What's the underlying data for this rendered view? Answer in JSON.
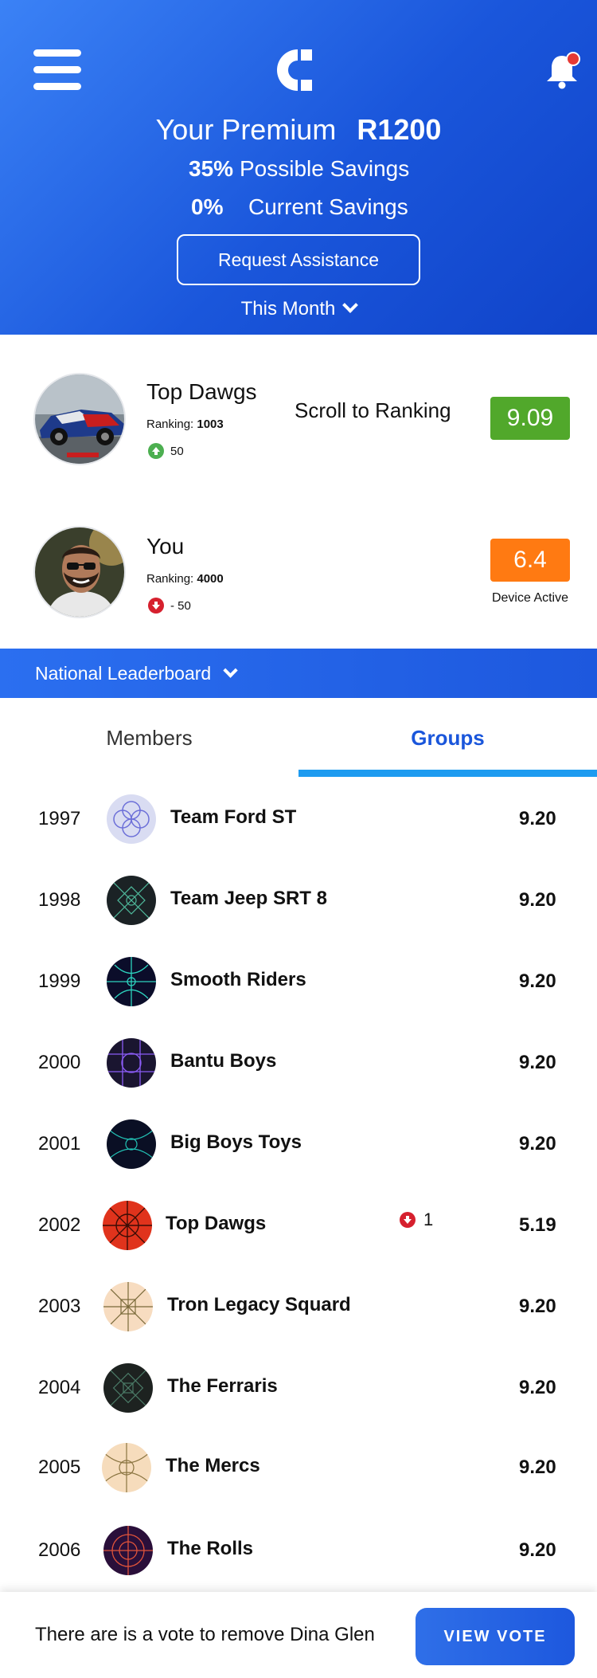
{
  "header": {
    "premium_label": "Your Premium",
    "premium_value": "R1200",
    "possible_pct": "35%",
    "possible_label": "Possible Savings",
    "current_pct": "0%",
    "current_label": "Current Savings",
    "assist_label": "Request Assistance",
    "period_label": "This Month"
  },
  "top_card": {
    "name": "Top Dawgs",
    "ranking_label": "Ranking:",
    "ranking_value": "1003",
    "change": "50",
    "scroll_label": "Scroll to Ranking",
    "score": "9.09"
  },
  "you_card": {
    "name": "You",
    "ranking_label": "Ranking:",
    "ranking_value": "4000",
    "change": "- 50",
    "score": "6.4",
    "status": "Device Active"
  },
  "leaderboard": {
    "label": "National Leaderboard"
  },
  "tabs": {
    "members": "Members",
    "groups": "Groups"
  },
  "rows": [
    {
      "rank": "1997",
      "name": "Team Ford ST",
      "score": "9.20"
    },
    {
      "rank": "1998",
      "name": "Team Jeep SRT 8",
      "score": "9.20"
    },
    {
      "rank": "1999",
      "name": "Smooth Riders",
      "score": "9.20"
    },
    {
      "rank": "2000",
      "name": "Bantu Boys",
      "score": "9.20"
    },
    {
      "rank": "2001",
      "name": "Big Boys Toys",
      "score": "9.20"
    },
    {
      "rank": "2002",
      "name": "Top Dawgs",
      "score": "5.19",
      "change": "1"
    },
    {
      "rank": "2003",
      "name": "Tron Legacy Squard",
      "score": "9.20"
    },
    {
      "rank": "2004",
      "name": "The Ferraris",
      "score": "9.20"
    },
    {
      "rank": "2005",
      "name": "The Mercs",
      "score": "9.20"
    },
    {
      "rank": "2006",
      "name": "The Rolls",
      "score": "9.20"
    }
  ],
  "footer": {
    "message": "There are is a vote to remove Dina Glen",
    "button": "VIEW VOTE"
  },
  "colors": {
    "header_blue": "#1a56db",
    "score_green": "#51a82b",
    "score_orange": "#ff7a12",
    "tab_underline": "#1e9bf0",
    "down_red": "#d6202e"
  },
  "icons": [
    "menu-icon",
    "brand-logo-icon",
    "bell-icon",
    "notification-dot-icon",
    "arrow-up-icon",
    "arrow-down-icon",
    "chevron-down-icon"
  ]
}
